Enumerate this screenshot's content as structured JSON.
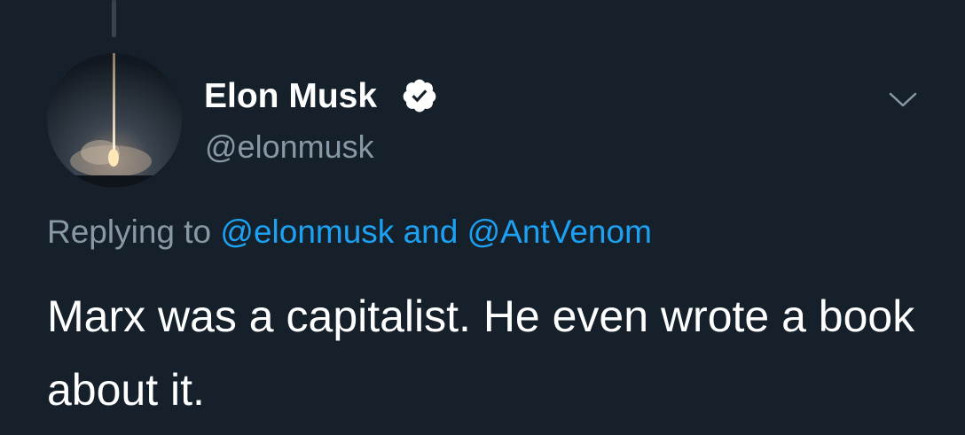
{
  "tweet": {
    "user": {
      "display_name": "Elon Musk",
      "handle": "@elonmusk",
      "verified": true,
      "avatar_icon": "rocket-launch-avatar"
    },
    "reply_context": {
      "prefix": "Replying to",
      "mention_1": "@elonmusk",
      "conjunction": "and",
      "mention_2": "@AntVenom"
    },
    "text": "Marx was a capitalist. He even wrote a book about it."
  },
  "icons": {
    "verified": "verified-badge-icon",
    "more": "chevron-down-icon"
  },
  "colors": {
    "background": "#15202b",
    "accent": "#1da1f2",
    "secondary_text": "#8899a6",
    "primary_text": "#ffffff"
  }
}
